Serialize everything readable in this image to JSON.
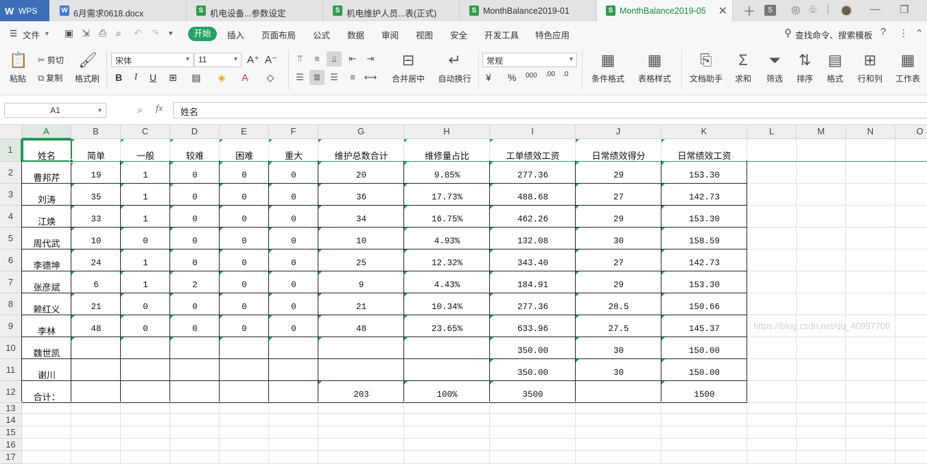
{
  "app": {
    "logo": "W",
    "name": "WPS"
  },
  "tabs": [
    {
      "name": "6月需求0618.docx",
      "type": "w"
    },
    {
      "name": "机电设备...参数设定",
      "type": "s"
    },
    {
      "name": "机电维护人员...表(正式)",
      "type": "s"
    },
    {
      "name": "MonthBalance2019-01",
      "type": "s"
    },
    {
      "name": "MonthBalance2019-05",
      "type": "s",
      "active": true
    }
  ],
  "tab_count": "5",
  "menu": {
    "file": "文件",
    "items": [
      "开始",
      "插入",
      "页面布局",
      "公式",
      "数据",
      "审阅",
      "视图",
      "安全",
      "开发工具",
      "特色应用"
    ],
    "search": "查找命令、搜索模板"
  },
  "ribbon": {
    "paste": "粘贴",
    "cut": "剪切",
    "copy": "复制",
    "format_painter": "格式刷",
    "font_name": "宋体",
    "font_size": "11",
    "merge_center": "合并居中",
    "wrap_text": "自动换行",
    "number_format": "常规",
    "cond_format": "条件格式",
    "table_style": "表格样式",
    "doc_assistant": "文档助手",
    "sum": "求和",
    "filter": "筛选",
    "sort": "排序",
    "format": "格式",
    "row_col": "行和列",
    "worksheet": "工作表"
  },
  "formula_bar": {
    "name_box": "A1",
    "fx": "fx",
    "value": "姓名"
  },
  "columns": [
    "A",
    "B",
    "C",
    "D",
    "E",
    "F",
    "G",
    "H",
    "I",
    "J",
    "K",
    "L",
    "M",
    "N",
    "O"
  ],
  "rows": [
    "1",
    "2",
    "3",
    "4",
    "5",
    "6",
    "7",
    "8",
    "9",
    "10",
    "11",
    "12",
    "13",
    "14",
    "15",
    "16",
    "17"
  ],
  "sheet": {
    "headers": [
      "姓名",
      "简单",
      "一般",
      "较难",
      "困难",
      "重大",
      "维护总数合计",
      "维修量占比",
      "工单绩效工资",
      "日常绩效得分",
      "日常绩效工资"
    ],
    "data": [
      [
        "曹邦芹",
        "19",
        "1",
        "0",
        "0",
        "0",
        "20",
        "9.85%",
        "277.36",
        "29",
        "153.30"
      ],
      [
        "刘涛",
        "35",
        "1",
        "0",
        "0",
        "0",
        "36",
        "17.73%",
        "488.68",
        "27",
        "142.73"
      ],
      [
        "江焕",
        "33",
        "1",
        "0",
        "0",
        "0",
        "34",
        "16.75%",
        "462.26",
        "29",
        "153.30"
      ],
      [
        "周代武",
        "10",
        "0",
        "0",
        "0",
        "0",
        "10",
        "4.93%",
        "132.08",
        "30",
        "158.59"
      ],
      [
        "李德坤",
        "24",
        "1",
        "0",
        "0",
        "0",
        "25",
        "12.32%",
        "343.40",
        "27",
        "142.73"
      ],
      [
        "张彦斌",
        "6",
        "1",
        "2",
        "0",
        "0",
        "9",
        "4.43%",
        "184.91",
        "29",
        "153.30"
      ],
      [
        "赖红义",
        "21",
        "0",
        "0",
        "0",
        "0",
        "21",
        "10.34%",
        "277.36",
        "28.5",
        "150.66"
      ],
      [
        "李林",
        "48",
        "0",
        "0",
        "0",
        "0",
        "48",
        "23.65%",
        "633.96",
        "27.5",
        "145.37"
      ],
      [
        "魏世凯",
        "",
        "",
        "",
        "",
        "",
        "",
        "",
        "350.00",
        "30",
        "150.00"
      ],
      [
        "谢川",
        "",
        "",
        "",
        "",
        "",
        "",
        "",
        "350.00",
        "30",
        "150.00"
      ],
      [
        "合计：",
        "",
        "",
        "",
        "",
        "",
        "203",
        "100%",
        "3500",
        "",
        "1500"
      ]
    ]
  },
  "watermark": "https://blog.csdn.net/qq_40997700",
  "colors": {
    "accent": "#21a366",
    "wps_blue": "#3b70b8",
    "grid": "#e3e3e3"
  }
}
